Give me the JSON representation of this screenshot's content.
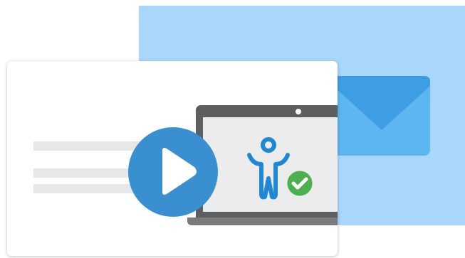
{
  "illustration": {
    "colors": {
      "back_panel": "#a9d6fb",
      "envelope": "#5eb6f0",
      "envelope_flap": "#3d9ee3",
      "card_background": "#ffffff",
      "text_placeholder": "#e6e7e8",
      "laptop_frame": "#5d5e60",
      "laptop_base": "#7a7b7d",
      "laptop_display": "#ececed",
      "play_button": "#3a8fd0",
      "play_glyph": "#ffffff",
      "accessibility_icon": "#1e88d6",
      "check_badge": "#4caf50",
      "check_glyph": "#ffffff"
    },
    "icons": {
      "envelope": "envelope-icon",
      "play": "play-icon",
      "accessibility": "accessibility-icon",
      "check": "checkmark-icon",
      "camera": "laptop-camera-icon"
    },
    "placeholder_text_lines": 3
  }
}
